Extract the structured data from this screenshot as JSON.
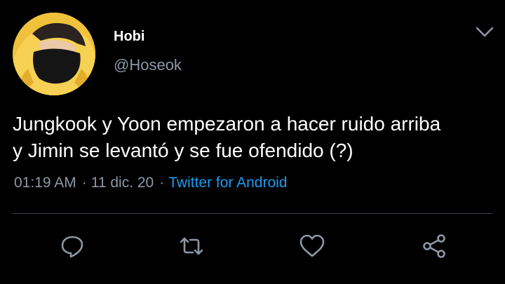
{
  "tweet": {
    "author": {
      "display_name": "Hobi",
      "handle": "@Hoseok"
    },
    "text": "Jungkook y Yoon empezaron a hacer ruido arriba\ny Jimin se levantó y se fue ofendido (?)",
    "time": "01:19 AM",
    "separator": "·",
    "date": "11 dic. 20",
    "client": "Twitter for Android"
  },
  "icons": {
    "menu": "chevron-down-icon",
    "reply": "reply-icon",
    "retweet": "retweet-icon",
    "like": "heart-icon",
    "share": "share-icon"
  },
  "colors": {
    "background": "#000000",
    "text": "#ffffff",
    "secondary_text": "#8b98a5",
    "link": "#1d9bf0",
    "divider": "#38444d",
    "icon": "#8b98a5"
  }
}
